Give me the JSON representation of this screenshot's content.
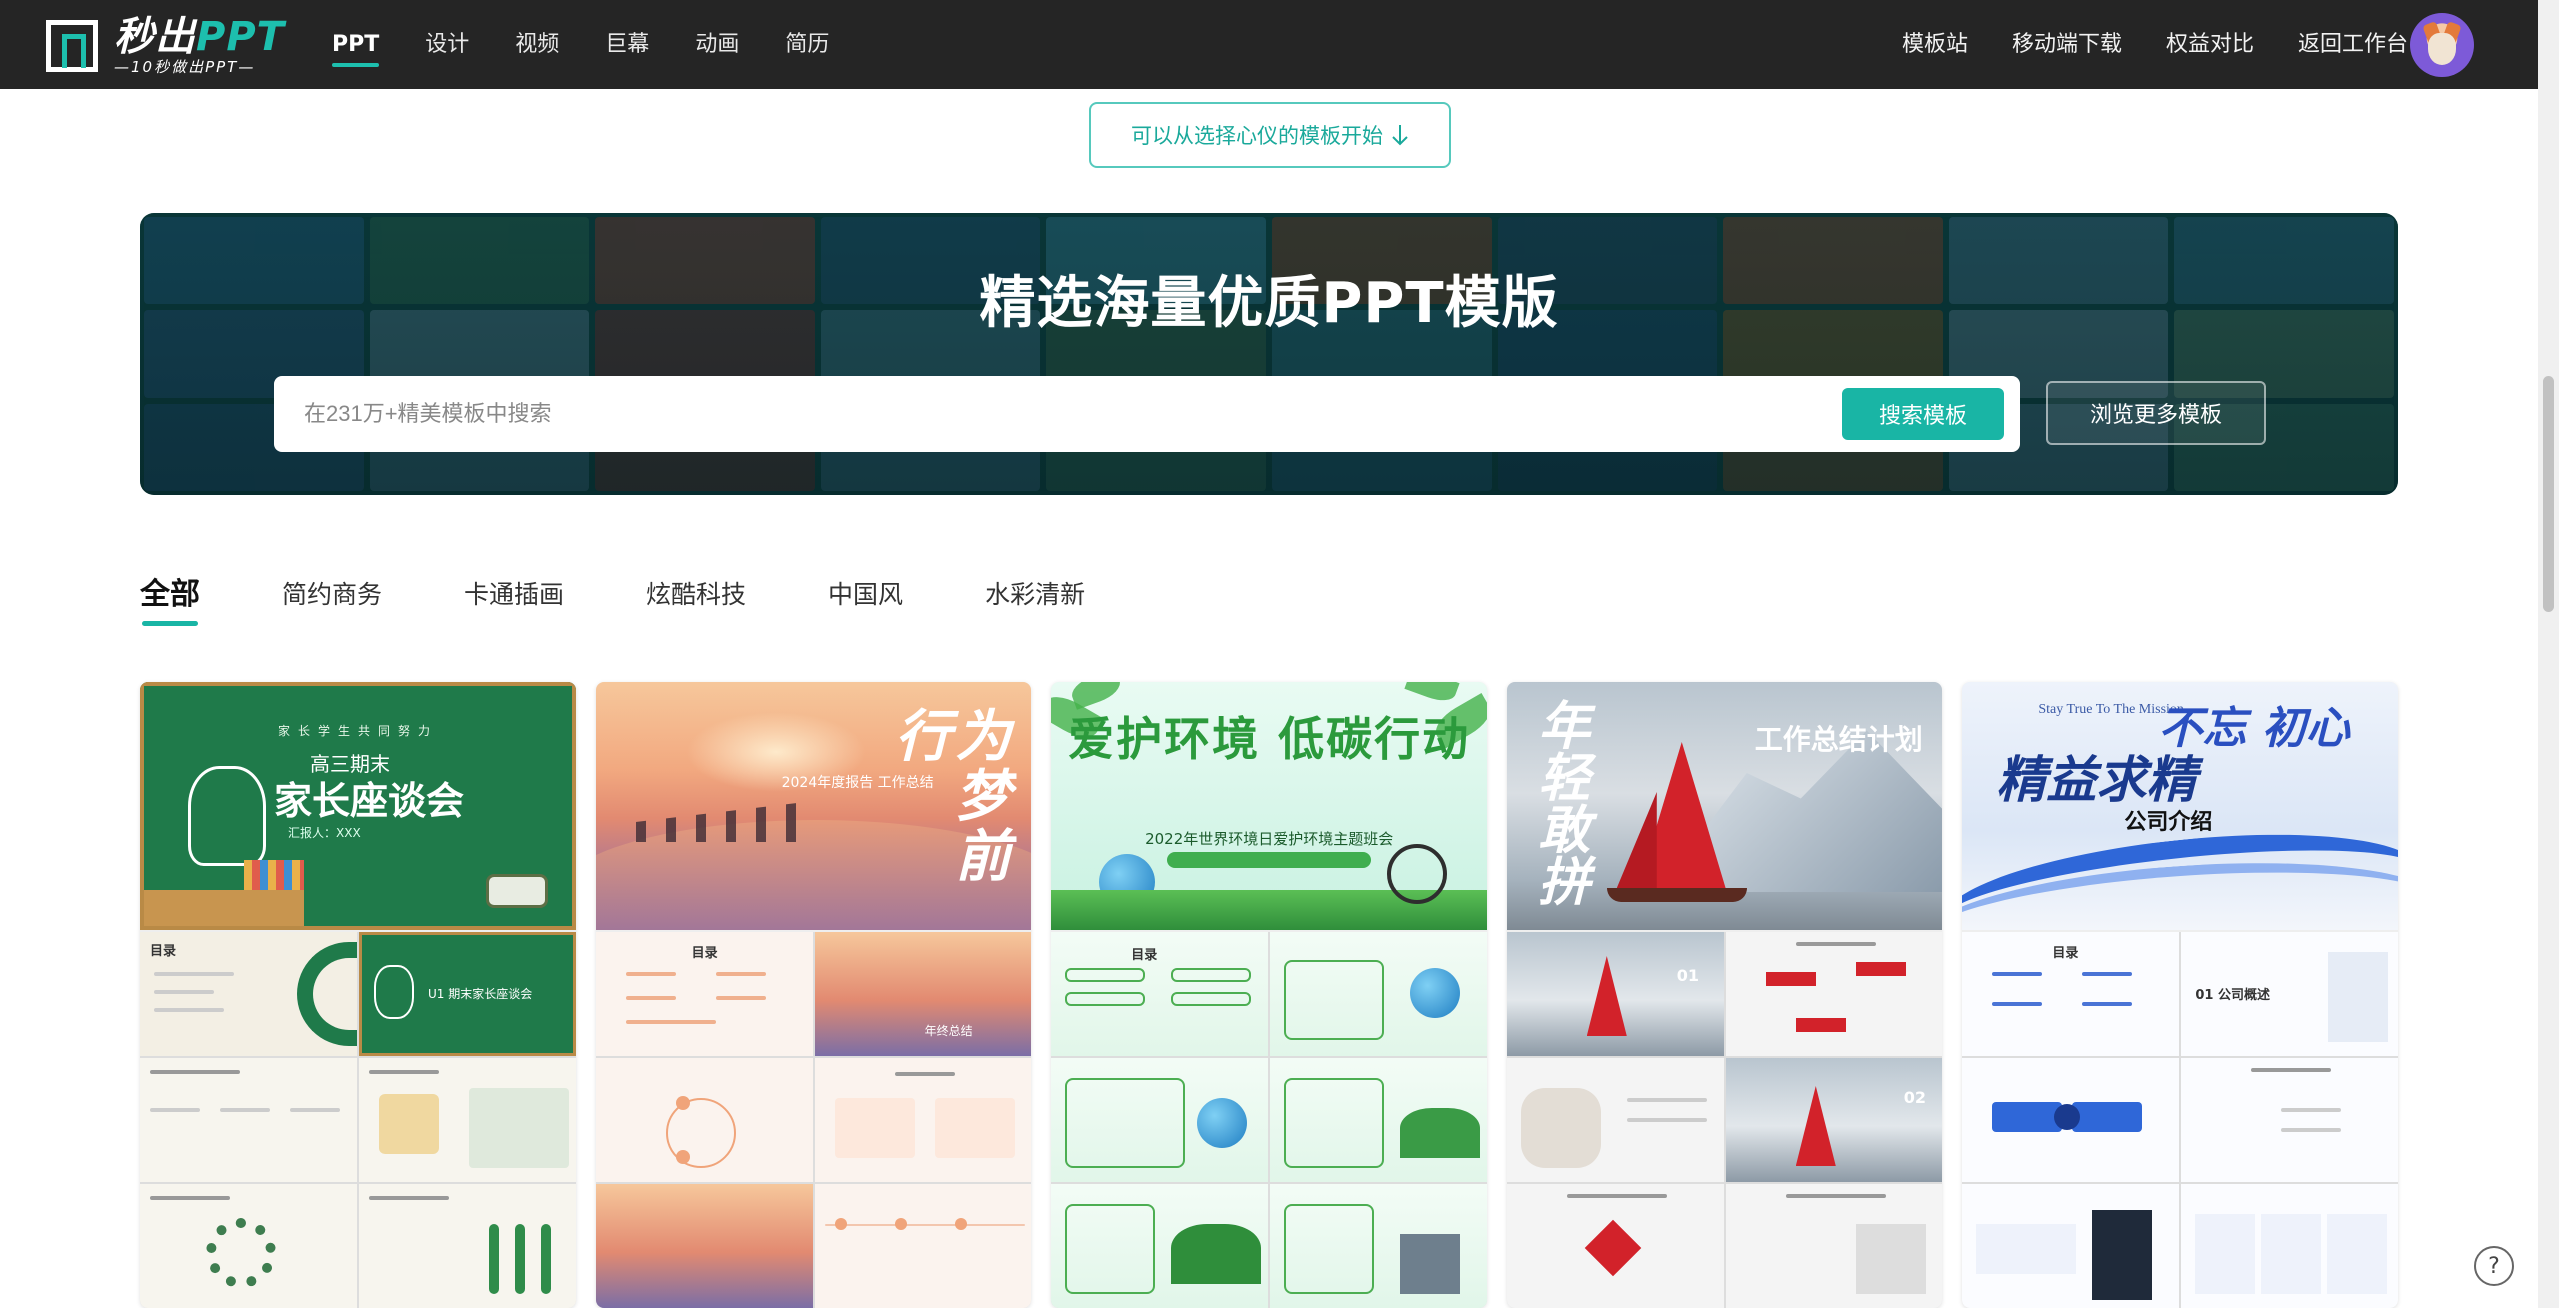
{
  "header": {
    "logo_title": "秒出",
    "logo_title_accent": "PPT",
    "logo_sub": "—10秒做出PPT—",
    "nav_left": [
      "PPT",
      "设计",
      "视频",
      "巨幕",
      "动画",
      "简历"
    ],
    "nav_right": [
      "模板站",
      "移动端下载",
      "权益对比",
      "返回工作台"
    ]
  },
  "hint_button": {
    "label": "可以从选择心仪的模板开始",
    "icon": "arrow-down-icon"
  },
  "banner": {
    "title": "精选海量优质PPT模版",
    "search_placeholder": "在231万+精美模板中搜索",
    "search_button": "搜索模板",
    "browse_button": "浏览更多模板"
  },
  "tabs": [
    "全部",
    "简约商务",
    "卡通插画",
    "炫酷科技",
    "中国风",
    "水彩清新"
  ],
  "cards": [
    {
      "cover_small": "家长学生共同努力",
      "cover_title_1": "高三期末",
      "cover_title_2": "家长座谈会",
      "cover_sub": "汇报人：XXX",
      "slide_title": "目录",
      "slide_caption": "U1 期末家长座谈会"
    },
    {
      "cover_calligraphy": "为梦前行",
      "cover_sub": "2024年度报告 工作总结",
      "slide_title": "目录",
      "slide_caption": "年终总结"
    },
    {
      "cover_title": "爱护环境 低碳行动",
      "cover_sub": "2022年世界环境日爱护环境主题班会",
      "slide_title": "目录"
    },
    {
      "cover_calligraphy": "年轻敢拼",
      "cover_title": "工作总结计划",
      "slide_num_1": "01",
      "slide_num_2": "02"
    },
    {
      "cover_en": "Stay True To The Mission",
      "cover_cn_1": "不忘 初心",
      "cover_cn_2": "精益求精",
      "cover_sub": "公司介绍",
      "slide_title": "目录",
      "slide_caption": "01 公司概述"
    }
  ],
  "help_icon": "question-mark-icon",
  "colors": {
    "accent": "#19b5a5",
    "topbar": "#252525"
  }
}
